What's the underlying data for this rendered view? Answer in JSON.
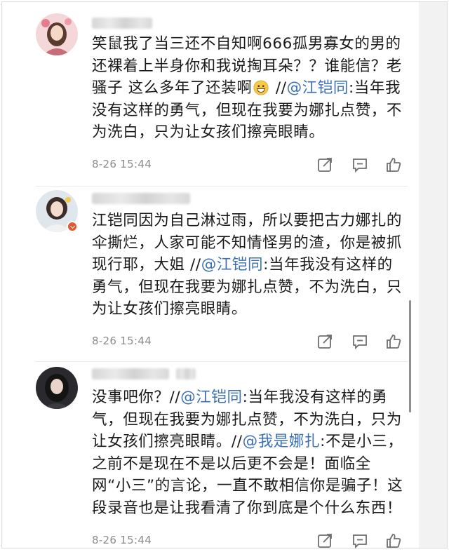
{
  "comments": [
    {
      "segments": [
        {
          "t": "笑鼠我了当三还不自知啊666孤男寡女的男的还裸着上半身你和我说掏耳朵？？谁能信？老骚子 这么多年了还装啊"
        },
        {
          "emoji": "grinning-face"
        },
        {
          "t": " //"
        },
        {
          "t": "@江铠同",
          "mention": true
        },
        {
          "t": ":当年我没有这样的勇气，但现在我要为娜扎点赞，不为洗白，只为让女孩们擦亮眼睛。"
        }
      ],
      "time": "8-26 15:44"
    },
    {
      "segments": [
        {
          "t": "江铠同因为自己淋过雨，所以要把古力娜扎的伞撕烂，人家可能不知情怪男的渣，你是被抓现行耶，大姐 //"
        },
        {
          "t": "@江铠同",
          "mention": true
        },
        {
          "t": ":当年我没有这样的勇气，但现在我要为娜扎点赞，不为洗白，只为让女孩们擦亮眼睛。"
        }
      ],
      "time": "8-26 15:44"
    },
    {
      "segments": [
        {
          "t": "没事吧你？//"
        },
        {
          "t": "@江铠同",
          "mention": true
        },
        {
          "t": ":当年我没有这样的勇气，但现在我要为娜扎点赞，不为洗白，只为让女孩们擦亮眼睛。//"
        },
        {
          "t": "@我是娜扎",
          "mention": true
        },
        {
          "t": ":不是小三，之前不是现在不是以后更不会是！面临全网“小三”的言论，一直不敢相信你是骗子！这段录音也是让我看清了你到底是个什么东西！"
        }
      ],
      "time": "8-26 15:44"
    }
  ],
  "icons": {
    "repost": "repost-icon",
    "comment": "comment-icon",
    "like": "thumbs-up-icon"
  },
  "colors": {
    "mention": "#3b6fb5",
    "timestamp": "#8c8c8c",
    "text": "#1a1a1a"
  }
}
